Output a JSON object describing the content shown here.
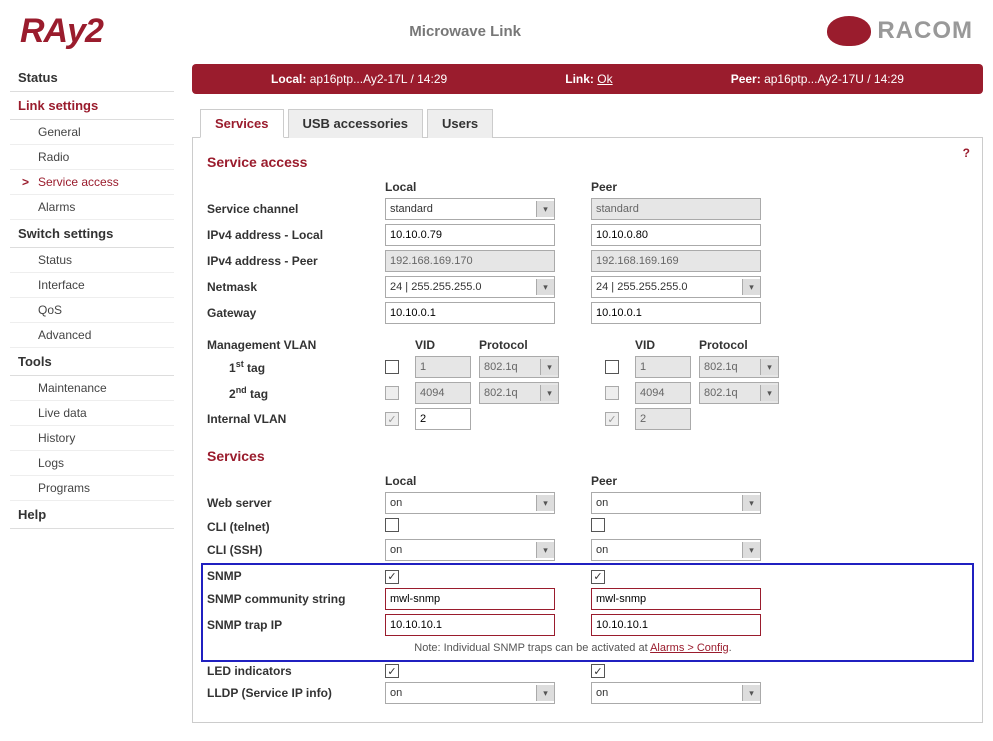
{
  "header": {
    "logo_left": "RAy2",
    "title": "Microwave Link",
    "logo_right": "RACOM"
  },
  "sidebar": {
    "groups": [
      {
        "label": "Status",
        "items": []
      },
      {
        "label": "Link settings",
        "active": true,
        "items": [
          {
            "label": "General"
          },
          {
            "label": "Radio"
          },
          {
            "label": "Service access",
            "active": true
          },
          {
            "label": "Alarms"
          }
        ]
      },
      {
        "label": "Switch settings",
        "items": [
          {
            "label": "Status"
          },
          {
            "label": "Interface"
          },
          {
            "label": "QoS"
          },
          {
            "label": "Advanced"
          }
        ]
      },
      {
        "label": "Tools",
        "items": [
          {
            "label": "Maintenance"
          },
          {
            "label": "Live data"
          },
          {
            "label": "History"
          },
          {
            "label": "Logs"
          },
          {
            "label": "Programs"
          }
        ]
      },
      {
        "label": "Help",
        "items": []
      }
    ]
  },
  "status_bar": {
    "local_label": "Local:",
    "local_value": "ap16ptp...Ay2-17L / 14:29",
    "link_label": "Link:",
    "link_value": "Ok",
    "peer_label": "Peer:",
    "peer_value": "ap16ptp...Ay2-17U / 14:29"
  },
  "tabs": [
    {
      "label": "Services",
      "active": true
    },
    {
      "label": "USB accessories"
    },
    {
      "label": "Users"
    }
  ],
  "help_icon": "?",
  "section_service_access": "Service access",
  "columns": {
    "local": "Local",
    "peer": "Peer",
    "vid": "VID",
    "protocol": "Protocol"
  },
  "rows": {
    "service_channel": {
      "label": "Service channel",
      "local": "standard",
      "peer": "standard"
    },
    "ipv4_local": {
      "label": "IPv4 address - Local",
      "local": "10.10.0.79",
      "peer": "10.10.0.80"
    },
    "ipv4_peer": {
      "label": "IPv4 address - Peer",
      "local": "192.168.169.170",
      "peer": "192.168.169.169"
    },
    "netmask": {
      "label": "Netmask",
      "local": "24  |  255.255.255.0",
      "peer": "24  |  255.255.255.0"
    },
    "gateway": {
      "label": "Gateway",
      "local": "10.10.0.1",
      "peer": "10.10.0.1"
    }
  },
  "vlan": {
    "label": "Management VLAN",
    "tag1_label_pre": "1",
    "tag1_label_sup": "st",
    "tag1_label_post": " tag",
    "tag2_label_pre": "2",
    "tag2_label_sup": "nd",
    "tag2_label_post": " tag",
    "tag1": {
      "local_chk": false,
      "local_vid": "1",
      "local_proto": "802.1q",
      "peer_chk": false,
      "peer_vid": "1",
      "peer_proto": "802.1q"
    },
    "tag2": {
      "local_chk": false,
      "local_vid": "4094",
      "local_proto": "802.1q",
      "peer_chk": false,
      "peer_vid": "4094",
      "peer_proto": "802.1q"
    },
    "internal_label": "Internal VLAN",
    "internal": {
      "local_chk": true,
      "local_vid": "2",
      "peer_chk": true,
      "peer_vid": "2"
    }
  },
  "section_services": "Services",
  "svc": {
    "web": {
      "label": "Web server",
      "local": "on",
      "peer": "on"
    },
    "telnet": {
      "label": "CLI (telnet)",
      "local_chk": false,
      "peer_chk": false
    },
    "ssh": {
      "label": "CLI (SSH)",
      "local": "on",
      "peer": "on"
    },
    "snmp": {
      "label": "SNMP",
      "local_chk": true,
      "peer_chk": true
    },
    "snmp_comm": {
      "label": "SNMP community string",
      "local": "mwl-snmp",
      "peer": "mwl-snmp"
    },
    "snmp_trap": {
      "label": "SNMP trap IP",
      "local": "10.10.10.1",
      "peer": "10.10.10.1"
    },
    "snmp_note_pre": "Note: Individual SNMP traps can be activated at ",
    "snmp_note_link": "Alarms > Config",
    "snmp_note_post": ".",
    "led": {
      "label": "LED indicators",
      "local_chk": true,
      "peer_chk": true
    },
    "lldp": {
      "label": "LLDP (Service IP info)",
      "local": "on",
      "peer": "on"
    }
  }
}
